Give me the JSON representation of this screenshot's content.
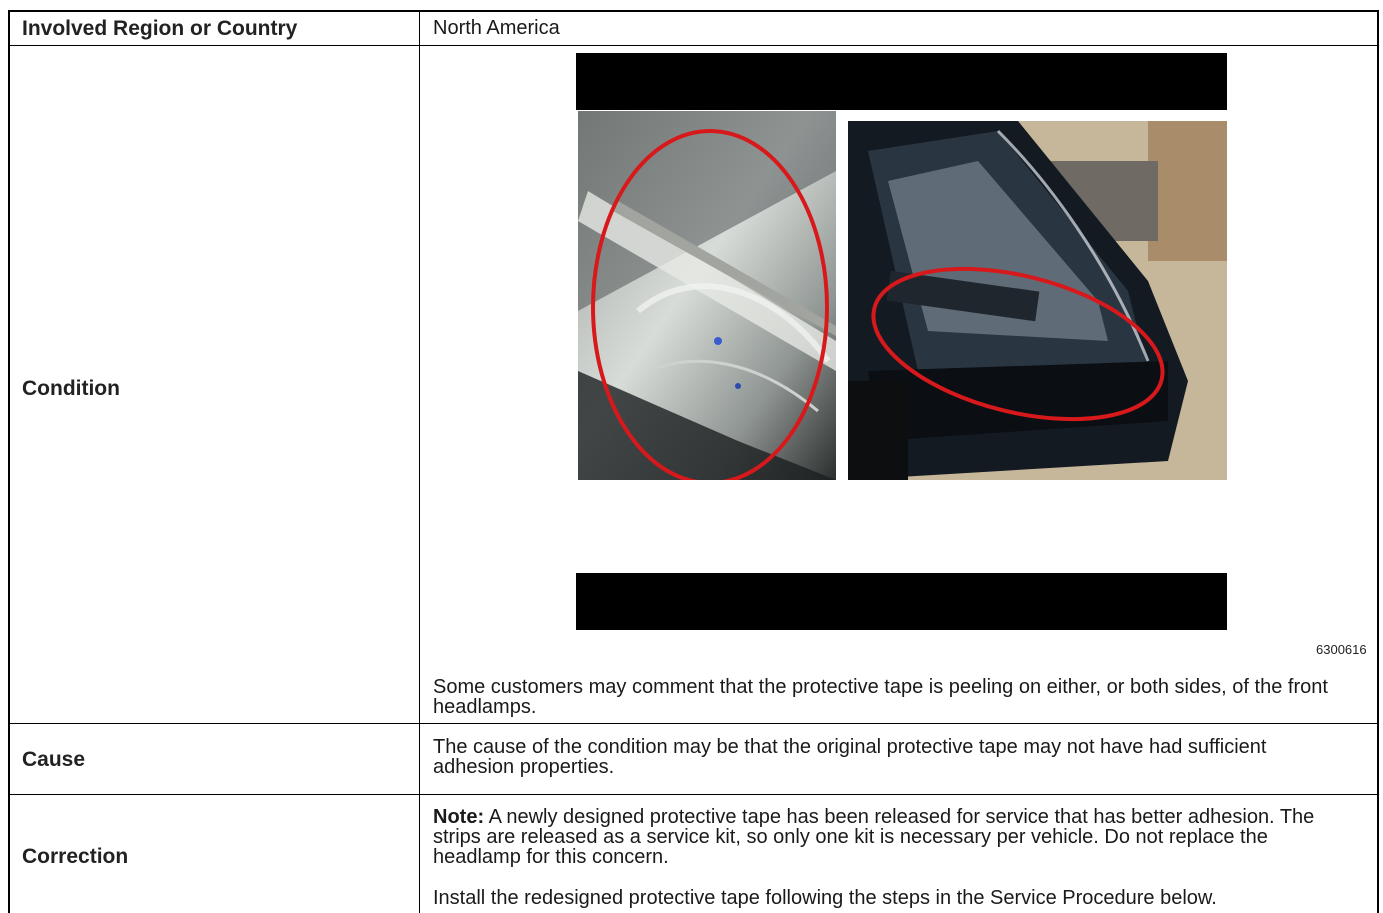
{
  "rows": {
    "region": {
      "label": "Involved Region or Country",
      "value": "North America"
    },
    "condition": {
      "label": "Condition",
      "figure_id": "6300616",
      "text": "Some customers may comment that the protective tape is peeling on either, or both sides, of the front headlamps."
    },
    "cause": {
      "label": "Cause",
      "text": "The cause of the condition may be that the original protective tape may not have had sufficient adhesion properties."
    },
    "correction": {
      "label": "Correction",
      "note_label": "Note:",
      "note_text": "A newly designed protective tape has been released for service that has better adhesion. The strips are released as a service kit, so only one kit is necessary per vehicle. Do not replace the headlamp for this concern.",
      "install_text": "Install the redesigned protective tape following the steps in the Service Procedure below."
    }
  },
  "colors": {
    "border": "#000000",
    "highlight_circle": "#d8191c"
  }
}
